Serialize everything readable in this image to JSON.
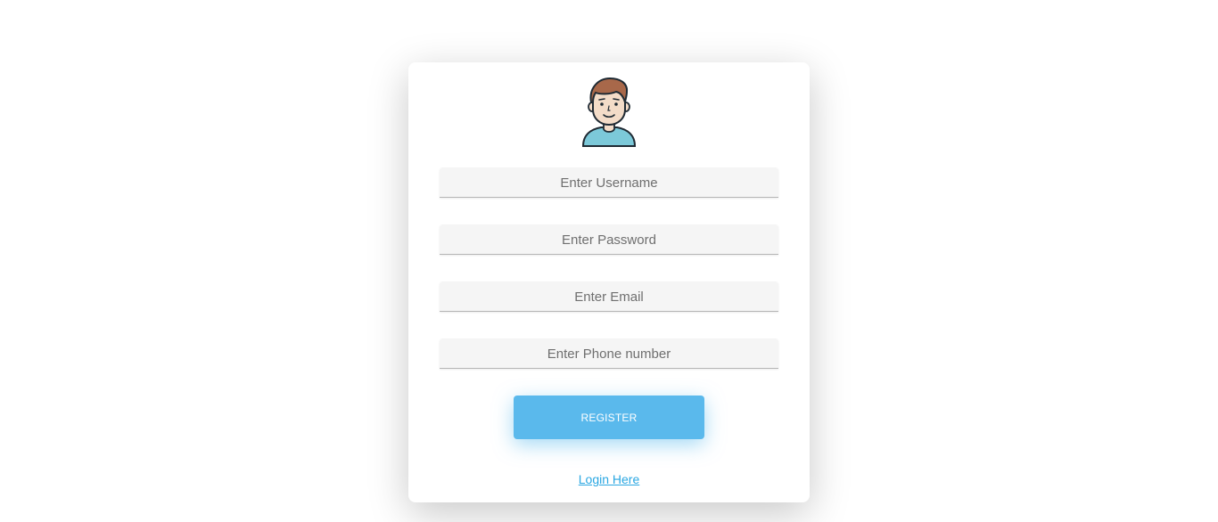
{
  "avatar": {
    "icon": "user-avatar-icon"
  },
  "form": {
    "fields": [
      {
        "name": "username",
        "placeholder": "Enter Username",
        "value": ""
      },
      {
        "name": "password",
        "placeholder": "Enter Password",
        "value": ""
      },
      {
        "name": "email",
        "placeholder": "Enter Email",
        "value": ""
      },
      {
        "name": "phone",
        "placeholder": "Enter Phone number",
        "value": ""
      }
    ],
    "register_label": "REGISTER",
    "login_link": "Login Here"
  },
  "colors": {
    "accent": "#5ab9ec",
    "link": "#2aa7e2",
    "field_bg": "#f5f5f5",
    "shirt": "#7cc9d9",
    "hair": "#a8684a",
    "skin": "#f3dcc8"
  }
}
